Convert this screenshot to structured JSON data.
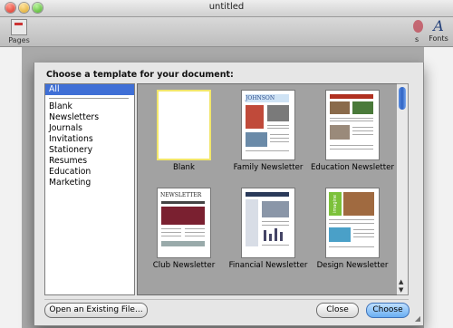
{
  "window": {
    "title": "untitled"
  },
  "toolbar": {
    "pages_label": "Pages",
    "fonts_label": "Fonts",
    "fonts_glyph": "A",
    "partial_label": "s"
  },
  "dialog": {
    "title": "Choose a template for your document:",
    "categories": [
      {
        "label": "All",
        "selected": true
      },
      {
        "label": "Blank"
      },
      {
        "label": "Newsletters"
      },
      {
        "label": "Journals"
      },
      {
        "label": "Invitations"
      },
      {
        "label": "Stationery"
      },
      {
        "label": "Resumes"
      },
      {
        "label": "Education"
      },
      {
        "label": "Marketing"
      }
    ],
    "templates": [
      {
        "label": "Blank",
        "selected": true
      },
      {
        "label": "Family Newsletter"
      },
      {
        "label": "Education Newsletter"
      },
      {
        "label": "Club Newsletter"
      },
      {
        "label": "Financial Newsletter"
      },
      {
        "label": "Design Newsletter"
      }
    ],
    "thumb_text": {
      "family": "JOHNSON",
      "club": "NEWSLETTER",
      "design": "imagine"
    },
    "buttons": {
      "open_existing": "Open an Existing File...",
      "close": "Close",
      "choose": "Choose"
    },
    "accent_color": "#3f6fd6"
  }
}
